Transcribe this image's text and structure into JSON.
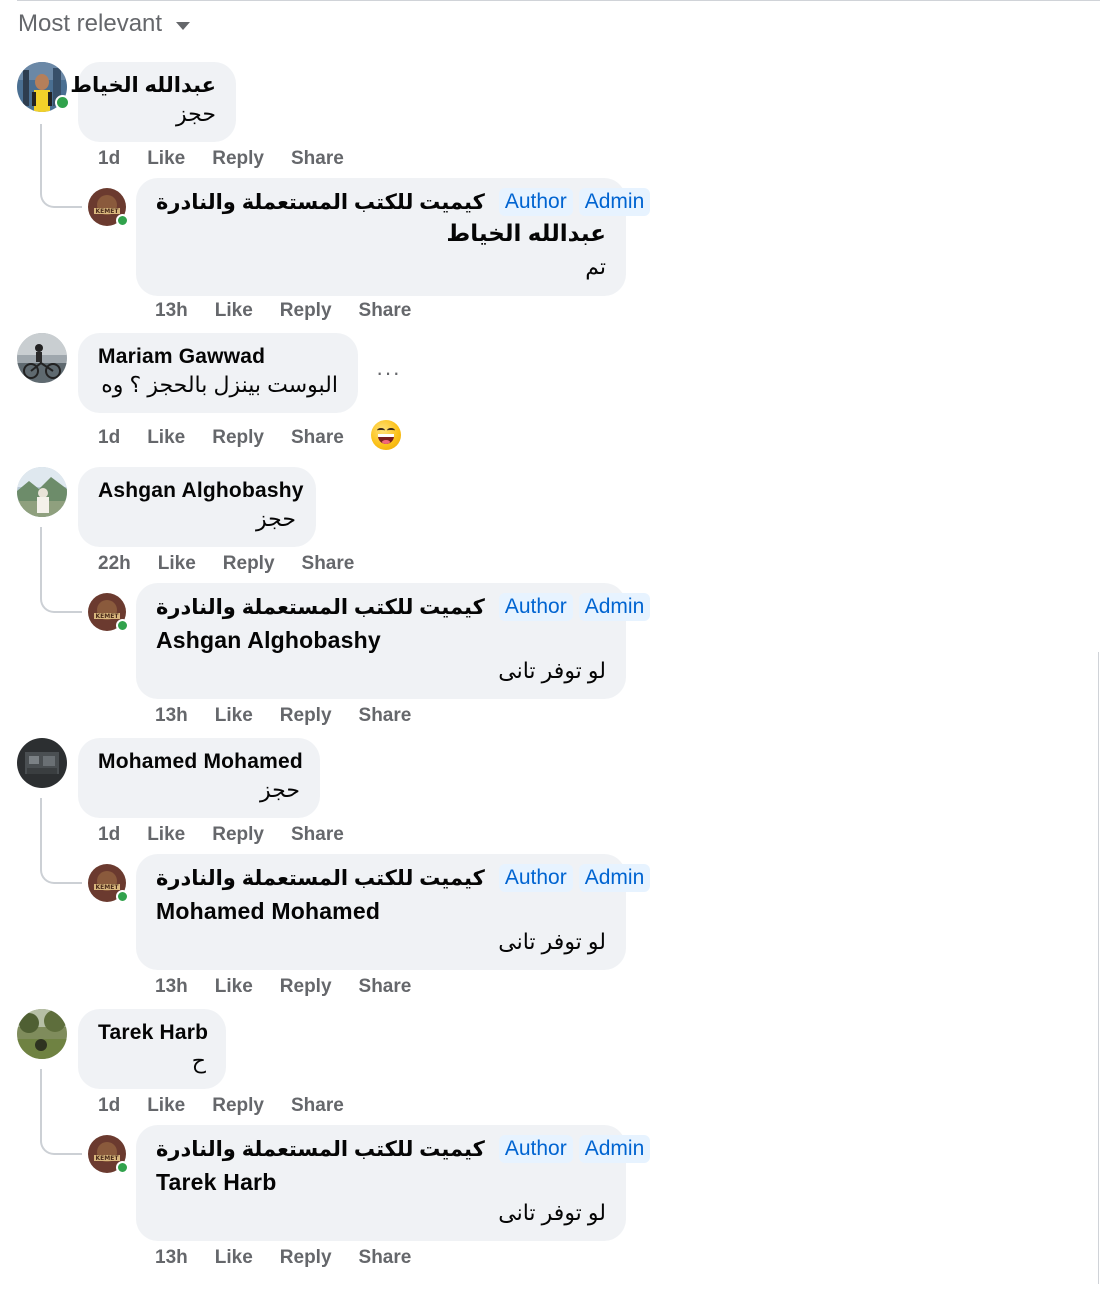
{
  "sort": {
    "label": "Most relevant"
  },
  "page_author_name": "كيميت للكتب المستعملة والنادرة",
  "badges": {
    "author": "Author",
    "admin": "Admin"
  },
  "action_labels": {
    "like": "Like",
    "reply": "Reply",
    "share": "Share"
  },
  "comments": [
    {
      "name": "عبدالله الخياط",
      "text": "حجز",
      "time": "1d",
      "reply": {
        "mention": "عبدالله الخياط",
        "text": "تم",
        "time": "13h"
      }
    },
    {
      "name": "Mariam Gawwad",
      "text": "البوست بينزل بالحجز ؟ وه",
      "time": "1d",
      "more": "···"
    },
    {
      "name": "Ashgan Alghobashy",
      "text": "حجز",
      "time": "22h",
      "reply": {
        "mention": "Ashgan Alghobashy",
        "text": "لو توفر تانى",
        "time": "13h"
      }
    },
    {
      "name": "Mohamed Mohamed",
      "text": "حجز",
      "time": "1d",
      "reply": {
        "mention": "Mohamed Mohamed",
        "text": "لو توفر تانى",
        "time": "13h"
      }
    },
    {
      "name": "Tarek Harb",
      "text": "ح",
      "time": "1d",
      "reply": {
        "mention": "Tarek Harb",
        "text": "لو توفر تانى",
        "time": "13h"
      }
    }
  ],
  "reaction_icon": "grinning-squinting-face-icon",
  "colors": {
    "bubble": "#f0f2f5",
    "meta": "#65676b",
    "badge": "#0064d1",
    "online": "#31a24c"
  }
}
